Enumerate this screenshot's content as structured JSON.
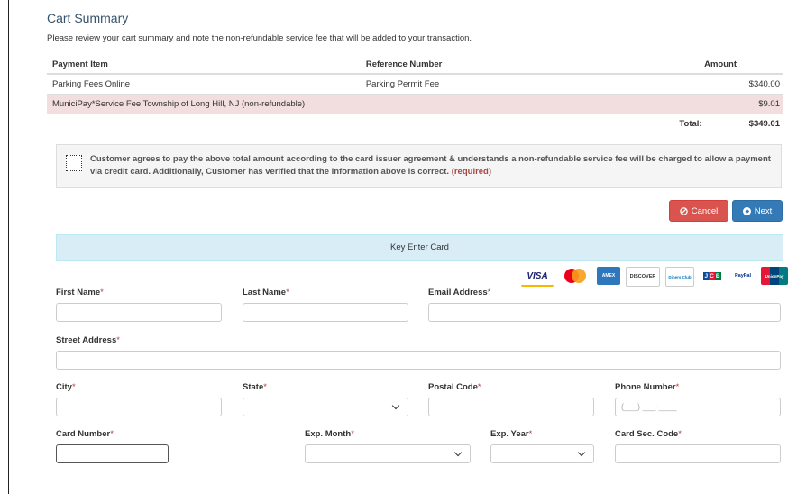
{
  "cart": {
    "title": "Cart Summary",
    "subtitle": "Please review your cart summary and note the non-refundable service fee that will be added to your transaction.",
    "headers": [
      "Payment Item",
      "Reference Number",
      "Amount"
    ],
    "rows": [
      {
        "item": "Parking Fees Online",
        "ref": "Parking Permit Fee",
        "amount": "$340.00"
      },
      {
        "item": "MuniciPay*Service Fee Township of Long Hill, NJ (non-refundable)",
        "ref": "",
        "amount": "$9.01"
      }
    ],
    "total_label": "Total:",
    "total_value": "$349.01"
  },
  "agreement": {
    "text": "Customer agrees to pay the above total amount according to the card issuer agreement & understands a non-refundable service fee will be charged to allow a payment via credit card. Additionally, Customer has verified that the information above is correct.",
    "required": "(required)"
  },
  "buttons": {
    "cancel": "Cancel",
    "next": "Next"
  },
  "colors": {
    "cancel": "#d9534f",
    "next": "#337ab7",
    "key_bar": "#d9edf7",
    "fee_row": "#f2dede",
    "required": "#a94442"
  },
  "key_enter": "Key Enter Card",
  "card_logos": [
    {
      "name": "VISA",
      "icon": "visa-logo"
    },
    {
      "name": "",
      "icon": "mastercard-logo"
    },
    {
      "name": "AMEX",
      "icon": "amex-logo"
    },
    {
      "name": "DISCOVER",
      "icon": "discover-logo"
    },
    {
      "name": "Diners Club",
      "icon": "diners-logo"
    },
    {
      "name": "JCB",
      "icon": "jcb-logo"
    },
    {
      "name": "PayPal",
      "icon": "paypal-logo"
    },
    {
      "name": "UnionPay",
      "icon": "unionpay-logo"
    }
  ],
  "form": {
    "first_name": "First Name",
    "last_name": "Last Name",
    "email": "Email Address",
    "street": "Street Address",
    "city": "City",
    "state": "State",
    "postal": "Postal Code",
    "phone": "Phone Number",
    "phone_placeholder": "(___) ___-____",
    "card_number": "Card Number",
    "exp_month": "Exp. Month",
    "exp_year": "Exp. Year",
    "sec_code": "Card Sec. Code",
    "required_mark": "*"
  }
}
